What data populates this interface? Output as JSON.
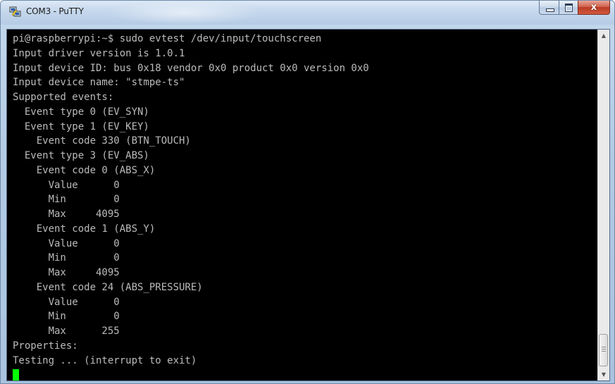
{
  "window": {
    "title": "COM3 - PuTTY",
    "app_icon": "putty-icon",
    "controls": {
      "minimize": "minimize-icon",
      "maximize": "maximize-icon",
      "close": "close-icon",
      "close_glyph": "x"
    }
  },
  "terminal": {
    "colors": {
      "background": "#000000",
      "foreground": "#bbbbbb",
      "cursor": "#00ff00"
    },
    "lines": [
      "pi@raspberrypi:~$ sudo evtest /dev/input/touchscreen",
      "Input driver version is 1.0.1",
      "Input device ID: bus 0x18 vendor 0x0 product 0x0 version 0x0",
      "Input device name: \"stmpe-ts\"",
      "Supported events:",
      "  Event type 0 (EV_SYN)",
      "  Event type 1 (EV_KEY)",
      "    Event code 330 (BTN_TOUCH)",
      "  Event type 3 (EV_ABS)",
      "    Event code 0 (ABS_X)",
      "      Value      0",
      "      Min        0",
      "      Max     4095",
      "    Event code 1 (ABS_Y)",
      "      Value      0",
      "      Min        0",
      "      Max     4095",
      "    Event code 24 (ABS_PRESSURE)",
      "      Value      0",
      "      Min        0",
      "      Max      255",
      "Properties:",
      "Testing ... (interrupt to exit)",
      ""
    ]
  },
  "scrollbar": {
    "up_arrow": "▲",
    "down_arrow": "▼"
  }
}
